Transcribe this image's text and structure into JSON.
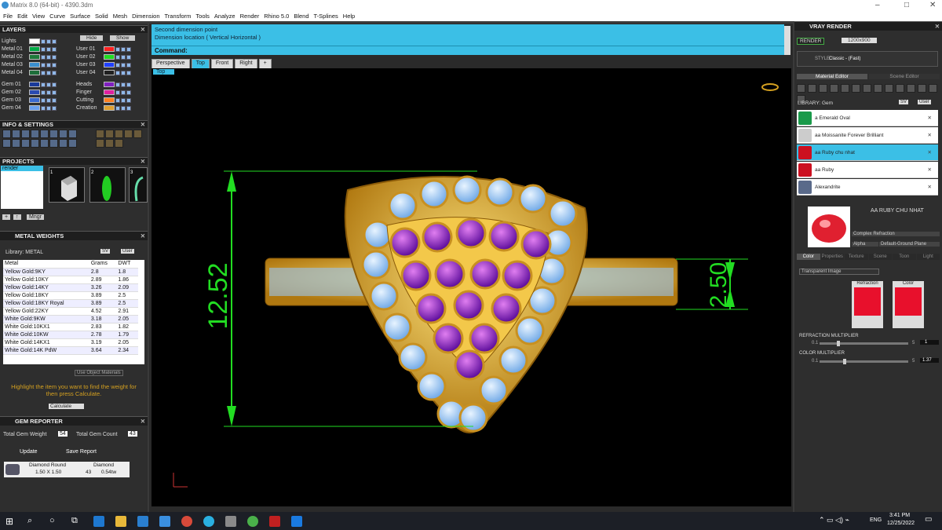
{
  "window": {
    "title": "Matrix 8.0 (64-bit) - 4390.3dm",
    "min": "–",
    "max": "□",
    "close": "✕"
  },
  "menu": [
    "File",
    "Edit",
    "View",
    "Curve",
    "Surface",
    "Solid",
    "Mesh",
    "Dimension",
    "Transform",
    "Tools",
    "Analyze",
    "Render",
    "Rhino 5.0",
    "Blend",
    "T-Splines",
    "Help"
  ],
  "layers": {
    "title": "LAYERS",
    "hide": "Hide",
    "show": "Show",
    "left": [
      {
        "name": "Lights",
        "color": "#ffffff"
      },
      {
        "name": "Metal 01",
        "color": "#00aa44"
      },
      {
        "name": "Metal 02",
        "color": "#1e7a3a"
      },
      {
        "name": "Metal 03",
        "color": "#3a8fd0"
      },
      {
        "name": "Metal 04",
        "color": "#1e6e3a"
      },
      {
        "name": "Gem 01",
        "color": "#1a3a9a"
      },
      {
        "name": "Gem 02",
        "color": "#2a4ab0"
      },
      {
        "name": "Gem 03",
        "color": "#3a6ad0"
      },
      {
        "name": "Gem 04",
        "color": "#6aa0f0"
      }
    ],
    "right": [
      {
        "name": "User 01",
        "color": "#ff2020"
      },
      {
        "name": "User 02",
        "color": "#20dd20"
      },
      {
        "name": "User 03",
        "color": "#2040ff"
      },
      {
        "name": "User 04",
        "color": "#202020"
      },
      {
        "name": "Heads",
        "color": "#8020c0"
      },
      {
        "name": "Finger",
        "color": "#e020a0"
      },
      {
        "name": "Cutting",
        "color": "#ff8020"
      },
      {
        "name": "Creation",
        "color": "#e0a030"
      }
    ]
  },
  "info": {
    "title": "INFO & SETTINGS"
  },
  "projects": {
    "title": "PROJECTS",
    "item": "render",
    "thumbs": [
      "1",
      "2",
      "3"
    ],
    "mngr": "Mngr"
  },
  "metal": {
    "title": "METAL WEIGHTS",
    "library": "Library: METAL",
    "sv": "SV",
    "user": "User",
    "headers": [
      "Metal",
      "Grams",
      "DWT"
    ],
    "rows": [
      [
        "Yellow Gold:9KY",
        "2.8",
        "1.8"
      ],
      [
        "Yellow Gold:10KY",
        "2.89",
        "1.86"
      ],
      [
        "Yellow Gold:14KY",
        "3.26",
        "2.09"
      ],
      [
        "Yellow Gold:18KY",
        "3.89",
        "2.5"
      ],
      [
        "Yellow Gold:18KY Royal",
        "3.89",
        "2.5"
      ],
      [
        "Yellow Gold:22KY",
        "4.52",
        "2.91"
      ],
      [
        "White Gold:9KW",
        "3.18",
        "2.05"
      ],
      [
        "White Gold:10KX1",
        "2.83",
        "1.82"
      ],
      [
        "White Gold:10KW",
        "2.78",
        "1.79"
      ],
      [
        "White Gold:14KX1",
        "3.19",
        "2.05"
      ],
      [
        "White Gold:14K PdW",
        "3.64",
        "2.34"
      ]
    ],
    "use_obj": "Use Object Materials",
    "hint": "Highlight the item you want to find the weight for then press Calculate.",
    "calc": "Calculate"
  },
  "gem": {
    "title": "GEM REPORTER",
    "total_weight_label": "Total Gem Weight",
    "total_weight": "54",
    "total_count_label": "Total Gem Count",
    "total_count": "43",
    "update": "Update",
    "save": "Save Report",
    "row": {
      "shape": "Diamond Round",
      "size": "1.50 X 1.50",
      "type": "Diamond",
      "count": "43",
      "weight": "0.54tw"
    }
  },
  "command": {
    "line1": "Second dimension point",
    "line2": "Dimension location ( Vertical  Horizontal )",
    "label": "Command:"
  },
  "viewtabs": [
    "Perspective",
    "Top",
    "Front",
    "Right",
    "+"
  ],
  "viewport": {
    "name": "Top",
    "dim_left": "12.52",
    "dim_right": "2.50"
  },
  "vray": {
    "title": "VRAY RENDER",
    "render": "RENDER",
    "res": "1200x900",
    "style_label": "STYLE:",
    "style": "Classic - (Fast)",
    "tab_mat": "Material Editor",
    "tab_scene": "Scene Editor",
    "library": "LIBRARY: Gem",
    "sv": "SV",
    "user": "User",
    "items": [
      {
        "name": "a Emerald Oval",
        "color": "#1a9a4a"
      },
      {
        "name": "aa Moissanite Forever Brilliant",
        "color": "#ccc"
      },
      {
        "name": "aa Ruby chu nhat",
        "color": "#cc1020"
      },
      {
        "name": "aa Ruby",
        "color": "#cc1020"
      },
      {
        "name": "Alexandrite",
        "color": "#5a6a8a"
      }
    ],
    "preview_name": "AA RUBY CHU NHAT",
    "type": "Complex Refraction",
    "alpha": "Alpha",
    "ground": "Default-Ground Plane",
    "subtabs": [
      "Color",
      "Properties",
      "Texture",
      "Scene",
      "Toon",
      "Light"
    ],
    "texture": "Transparent Image",
    "refraction": "Refraction",
    "color": "Color",
    "refr_mult_label": "REFRACTION MULTIPLIER",
    "refr_min": "0.1",
    "refr_max": "5",
    "refr_val": "1",
    "col_mult_label": "COLOR MULTIPLIER",
    "col_min": "0.1",
    "col_max": "5",
    "col_val": "1.37"
  },
  "taskbar": {
    "lang": "ENG",
    "time": "3:41 PM",
    "date": "12/25/2022"
  }
}
